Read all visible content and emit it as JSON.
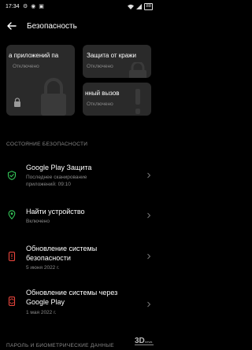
{
  "status_bar": {
    "time": "17:34",
    "left_icons": "⚙ ◉ ▣",
    "battery": "88"
  },
  "header": {
    "title": "Безопасность"
  },
  "cards": [
    {
      "title": "а приложений па",
      "status": "Отключено"
    },
    {
      "title": "Защита от кражи",
      "status": "Отключено"
    },
    {
      "title": "нный вызов",
      "status": "Отключено"
    }
  ],
  "section_security": "СОСТОЯНИЕ БЕЗОПАСНОСТИ",
  "items": [
    {
      "title": "Google Play Защита",
      "subtitle": "Последнее сканирование приложений: 09:10",
      "icon": "shield-check-icon"
    },
    {
      "title": "Найти устройство",
      "subtitle": "Включено",
      "icon": "location-pin-icon"
    },
    {
      "title": "Обновление системы безопасности",
      "subtitle": "5 июня 2022 г.",
      "icon": "phone-alert-icon"
    },
    {
      "title": "Обновление системы через Google Play",
      "subtitle": "1 мая 2022 г.",
      "icon": "phone-sync-icon"
    }
  ],
  "section_bottom": "ПАРОЛЬ И БИОМЕТРИЧЕСКИЕ ДАННЫЕ",
  "watermark_text": "3D news",
  "colors": {
    "accent_green": "#34c759",
    "alert_red": "#e8453c",
    "background": "#000000",
    "card": "#2a2a2a"
  }
}
